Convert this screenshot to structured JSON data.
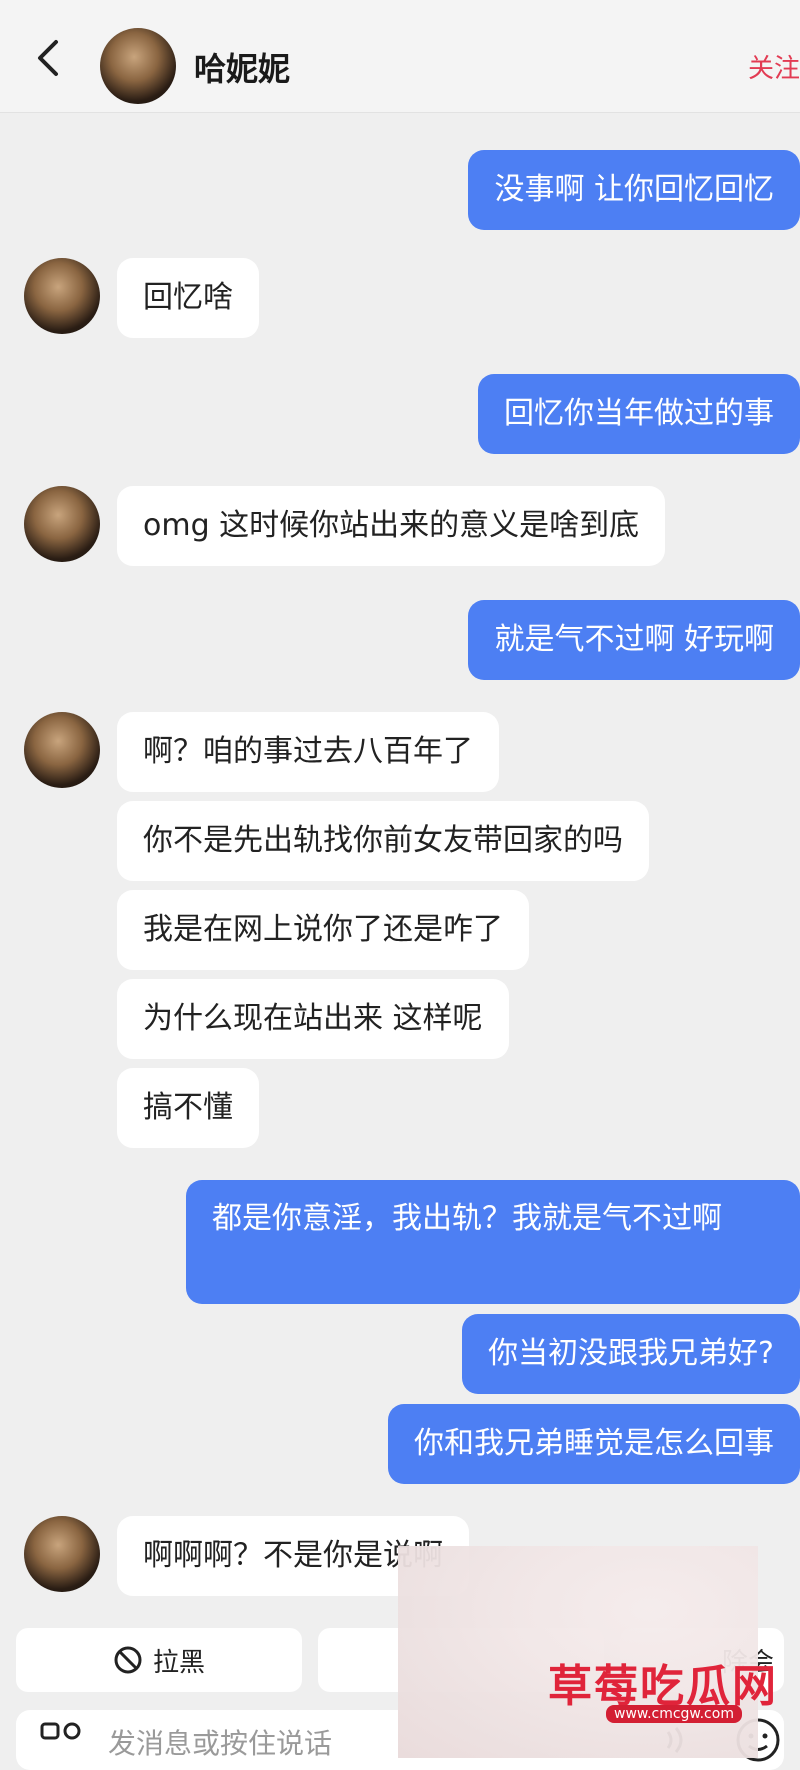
{
  "header": {
    "title": "哈妮妮",
    "follow_label": "关注"
  },
  "messages": [
    {
      "side": "sent",
      "text": "没事啊 让你回忆回忆"
    },
    {
      "side": "recv",
      "text": "回忆啥"
    },
    {
      "side": "sent",
      "text": "回忆你当年做过的事"
    },
    {
      "side": "recv",
      "text": "omg 这时候你站出来的意义是啥到底"
    },
    {
      "side": "sent",
      "text": "就是气不过啊 好玩啊"
    },
    {
      "side": "recv",
      "text": "啊？咱的事过去八百年了"
    },
    {
      "side": "recv",
      "text": "你不是先出轨找你前女友带回家的吗"
    },
    {
      "side": "recv",
      "text": "我是在网上说你了还是咋了"
    },
    {
      "side": "recv",
      "text": "为什么现在站出来 这样呢"
    },
    {
      "side": "recv",
      "text": "搞不懂"
    },
    {
      "side": "sent",
      "text": "都是你意淫，我出轨？我就是气不过啊"
    },
    {
      "side": "sent",
      "text": "你当初没跟我兄弟好?"
    },
    {
      "side": "sent",
      "text": "你和我兄弟睡觉是怎么回事"
    },
    {
      "side": "recv",
      "text": "啊啊啊？不是你是说啊"
    }
  ],
  "bottom": {
    "block_label": "拉黑",
    "delete_label": "除会",
    "input_placeholder": "发消息或按住说话"
  },
  "watermark": {
    "text": "草莓吃瓜网",
    "url": "www.cmcgw.com"
  },
  "colors": {
    "sent_bubble": "#4d7ff3",
    "received_bubble": "#ffffff",
    "background": "#efefef",
    "follow": "#e23b53"
  }
}
